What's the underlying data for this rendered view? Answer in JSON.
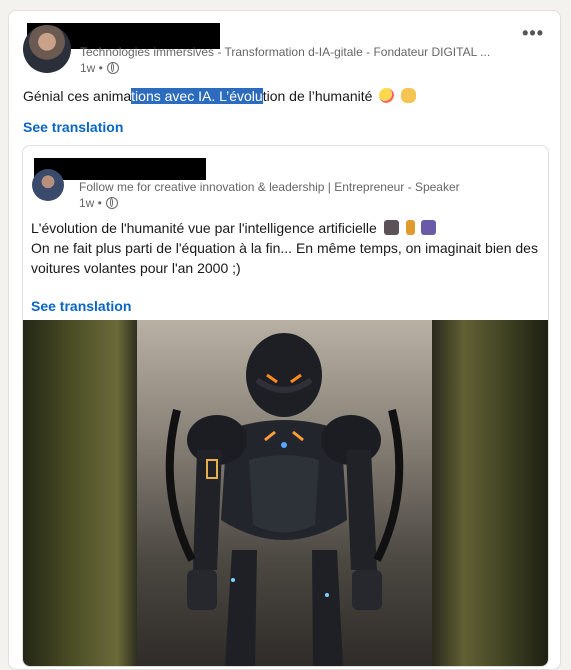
{
  "post": {
    "headline": "Technologies immersives - Transformation d-IA-gitale - Fondateur DIGITAL ...",
    "time": "1w •",
    "text_before": "Génial ces anima",
    "text_highlight": "tions avec IA. L’évolu",
    "text_after": "tion de l’humanité",
    "see_translation": "See translation"
  },
  "shared": {
    "headline": "Follow me for creative innovation & leadership | Entrepreneur - Speaker",
    "time": "1w •",
    "line1": "L'évolution de l'humanité vue par l'intelligence artificielle",
    "line2": "On ne fait plus parti de l'équation à la fin... En même temps, on imaginait bien des",
    "line3": "voitures volantes pour l'an 2000 ;)",
    "see_translation": "See translation"
  },
  "icons": {
    "more": "more-options-icon",
    "globe": "globe-icon",
    "emoji_face": "zany-face-emoji",
    "emoji_hand": "ok-hand-emoji",
    "emoji_ape": "gorilla-emoji",
    "emoji_walker": "person-walking-emoji",
    "emoji_robot": "robot-emoji"
  }
}
